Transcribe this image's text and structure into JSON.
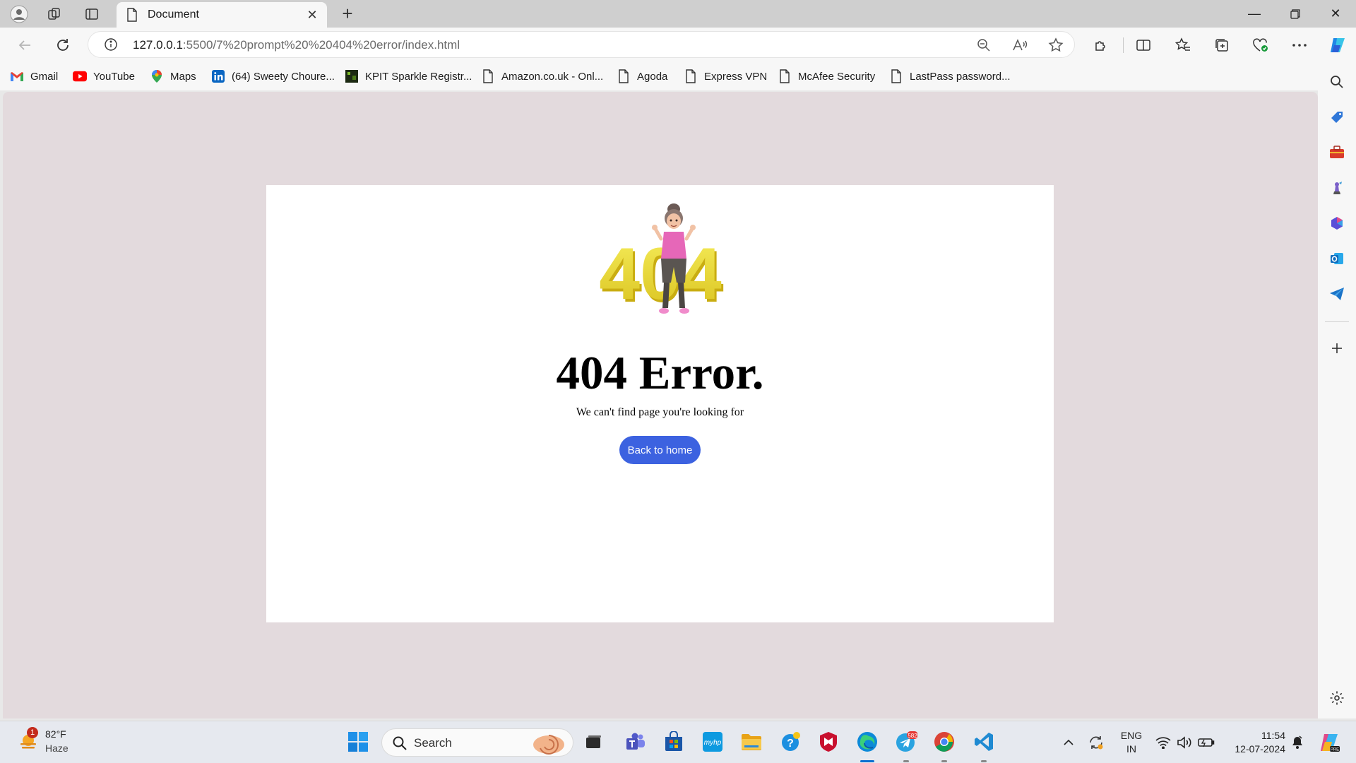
{
  "browser": {
    "tab_title": "Document",
    "url_host": "127.0.0.1",
    "url_rest": ":5500/7%20prompt%20%20404%20error/index.html"
  },
  "bookmarks": [
    {
      "label": "Gmail",
      "icon": "gmail-icon"
    },
    {
      "label": "YouTube",
      "icon": "youtube-icon"
    },
    {
      "label": "Maps",
      "icon": "maps-icon"
    },
    {
      "label": "(64) Sweety Choure...",
      "icon": "linkedin-icon"
    },
    {
      "label": "KPIT Sparkle Registr...",
      "icon": "kpit-icon"
    },
    {
      "label": "Amazon.co.uk - Onl...",
      "icon": "page-icon"
    },
    {
      "label": "Agoda",
      "icon": "page-icon"
    },
    {
      "label": "Express VPN",
      "icon": "page-icon"
    },
    {
      "label": "McAfee Security",
      "icon": "page-icon"
    },
    {
      "label": "LastPass password...",
      "icon": "page-icon"
    }
  ],
  "page": {
    "hero_numbers": "404",
    "title": "404 Error.",
    "subtitle": "We can't find page you're looking for",
    "button_label": "Back to home",
    "accent": "#3c62e0"
  },
  "taskbar": {
    "weather_badge": "1",
    "weather_temp": "82°F",
    "weather_condition": "Haze",
    "search_label": "Search",
    "telegram_badge": "582",
    "lang_line1": "ENG",
    "lang_line2": "IN",
    "time": "11:54",
    "date": "12-07-2024"
  }
}
